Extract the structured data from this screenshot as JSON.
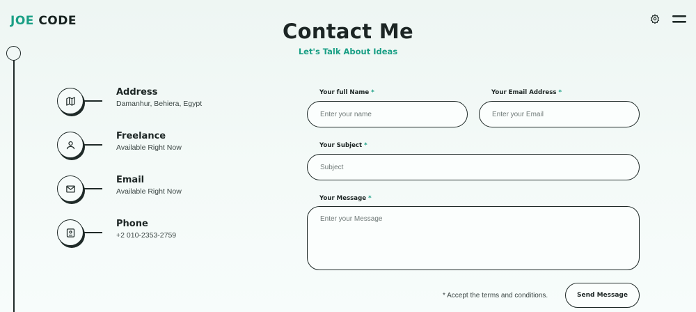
{
  "brand": {
    "logo_part1": "JOE",
    "logo_part2": "CODE"
  },
  "header": {
    "title": "Contact Me",
    "subtitle": "Let's Talk About Ideas"
  },
  "icons": {
    "settings": "gear-icon",
    "menu": "hamburger-menu-icon"
  },
  "colors": {
    "accent": "#1a9f85",
    "ink": "#1f2a28",
    "background": "#eef6f3"
  },
  "contact_info": [
    {
      "title": "Address",
      "subtitle": "Damanhur, Behiera, Egypt",
      "icon": "map-icon"
    },
    {
      "title": "Freelance",
      "subtitle": "Available Right Now",
      "icon": "user-icon"
    },
    {
      "title": "Email",
      "subtitle": "Available Right Now",
      "icon": "mail-icon"
    },
    {
      "title": "Phone",
      "subtitle": "+2 010-2353-2759",
      "icon": "contact-book-icon"
    }
  ],
  "form": {
    "name_label": "Your full Name",
    "name_placeholder": "Enter your name",
    "email_label": "Your Email Address",
    "email_placeholder": "Enter your Email",
    "subject_label": "Your Subject",
    "subject_placeholder": "Subject",
    "message_label": "Your Message",
    "message_placeholder": "Enter your Message",
    "required_mark": "*",
    "terms_text": "* Accept the terms and conditions.",
    "submit_label": "Send Message"
  }
}
